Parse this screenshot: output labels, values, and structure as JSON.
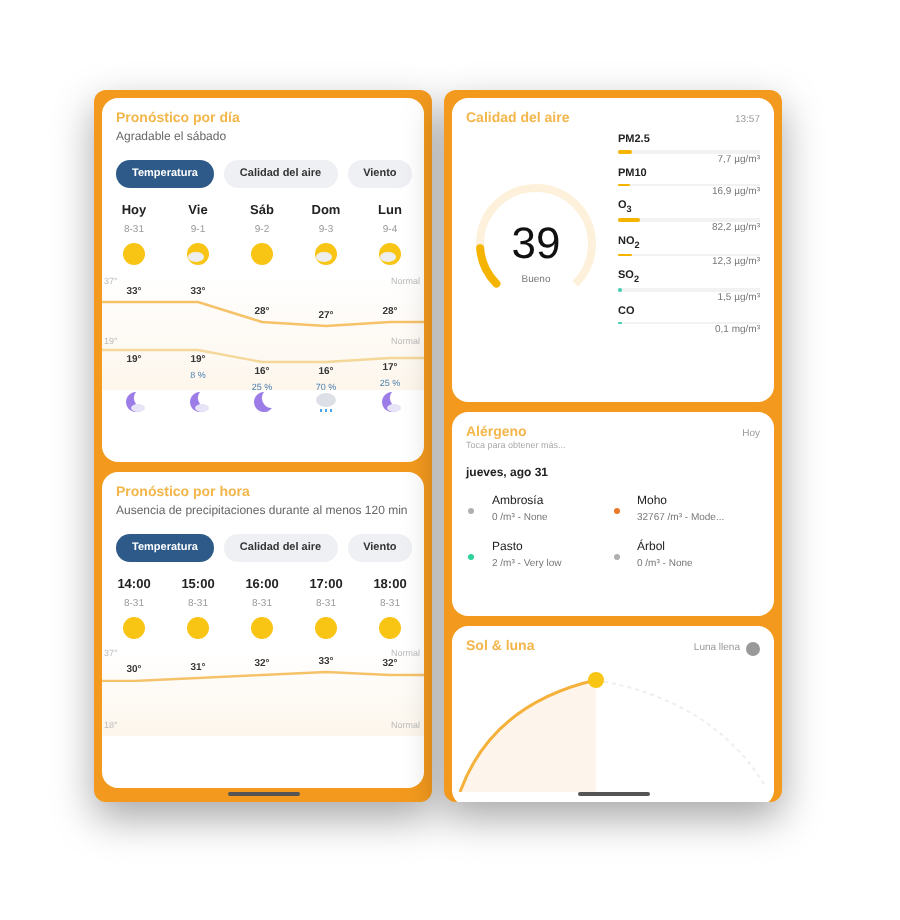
{
  "daily": {
    "title": "Pronóstico por día",
    "subtitle": "Agradable el sábado",
    "tabs": [
      {
        "label": "Temperatura",
        "selected": true
      },
      {
        "label": "Calidad del aire",
        "selected": false
      },
      {
        "label": "Viento",
        "selected": false
      }
    ],
    "axis": {
      "top": "37°",
      "bottom": "19°",
      "top_note": "Normal",
      "bottom_note": "Normal"
    },
    "days": [
      {
        "day": "Hoy",
        "date": "8-31",
        "kind": "sun",
        "high": "33°",
        "low": "19°",
        "night": {
          "kind": "moon-cloud"
        }
      },
      {
        "day": "Vie",
        "date": "9-1",
        "kind": "sun-cloud",
        "high": "33°",
        "low": "19°",
        "precip": "8 %",
        "night": {
          "kind": "moon-cloud"
        }
      },
      {
        "day": "Sáb",
        "date": "9-2",
        "kind": "sun",
        "high": "28°",
        "low": "16°",
        "precip": "25 %",
        "night": {
          "kind": "moon"
        }
      },
      {
        "day": "Dom",
        "date": "9-3",
        "kind": "sun-cloud",
        "high": "27°",
        "low": "16°",
        "precip": "70 %",
        "night": {
          "kind": "rain"
        }
      },
      {
        "day": "Lun",
        "date": "9-4",
        "kind": "sun-cloud",
        "high": "28°",
        "low": "17°",
        "precip": "25 %",
        "night": {
          "kind": "moon-cloud"
        }
      }
    ]
  },
  "hourly": {
    "title": "Pronóstico por hora",
    "subtitle": "Ausencia de precipitaciones durante al menos 120 min",
    "tabs": [
      {
        "label": "Temperatura",
        "selected": true
      },
      {
        "label": "Calidad del aire",
        "selected": false
      },
      {
        "label": "Viento",
        "selected": false
      }
    ],
    "axis": {
      "top": "37°",
      "bottom": "18°",
      "top_note": "Normal",
      "bottom_note": "Normal"
    },
    "hours": [
      {
        "time": "14:00",
        "date": "8-31",
        "kind": "sun",
        "temp": "30°"
      },
      {
        "time": "15:00",
        "date": "8-31",
        "kind": "sun",
        "temp": "31°"
      },
      {
        "time": "16:00",
        "date": "8-31",
        "kind": "sun",
        "temp": "32°"
      },
      {
        "time": "17:00",
        "date": "8-31",
        "kind": "sun",
        "temp": "33°"
      },
      {
        "time": "18:00",
        "date": "8-31",
        "kind": "sun",
        "temp": "32°"
      }
    ]
  },
  "air": {
    "title": "Calidad del aire",
    "time": "13:57",
    "index": "39",
    "rating": "Bueno",
    "level": 0.15,
    "pollutants": [
      {
        "name": "PM2.5",
        "value": "7,7 µg/m³",
        "level": 0.1,
        "color": "#f5b400"
      },
      {
        "name": "PM10",
        "value": "16,9 µg/m³",
        "level": 0.08,
        "color": "#f5b400"
      },
      {
        "name": "O$_{3}$",
        "value": "82,2 µg/m³",
        "level": 0.15,
        "color": "#f5b400"
      },
      {
        "name": "NO$_{2}$",
        "value": "12,3 µg/m³",
        "level": 0.1,
        "color": "#f5b400"
      },
      {
        "name": "SO$_{2}$",
        "value": "1,5 µg/m³",
        "level": 0.02,
        "color": "#3ccfb0"
      },
      {
        "name": "CO",
        "value": "0,1 mg/m³",
        "level": 0.02,
        "color": "#3ccfb0"
      }
    ]
  },
  "allergen": {
    "title": "Alérgeno",
    "subtitle": "Toca para obtener más...",
    "when": "Hoy",
    "date": "jueves, ago 31",
    "items": [
      {
        "name": "Ambrosía",
        "detail": "0 /m³ - None",
        "color": "#b0b0b0"
      },
      {
        "name": "Moho",
        "detail": "32767 /m³ - Mode...",
        "color": "#e8792a"
      },
      {
        "name": "Pasto",
        "detail": "2 /m³ - Very low",
        "color": "#2ed39a"
      },
      {
        "name": "Árbol",
        "detail": "0 /m³ - None",
        "color": "#b0b0b0"
      }
    ]
  },
  "sun": {
    "title": "Sol & luna",
    "moon": "Luna llena"
  }
}
